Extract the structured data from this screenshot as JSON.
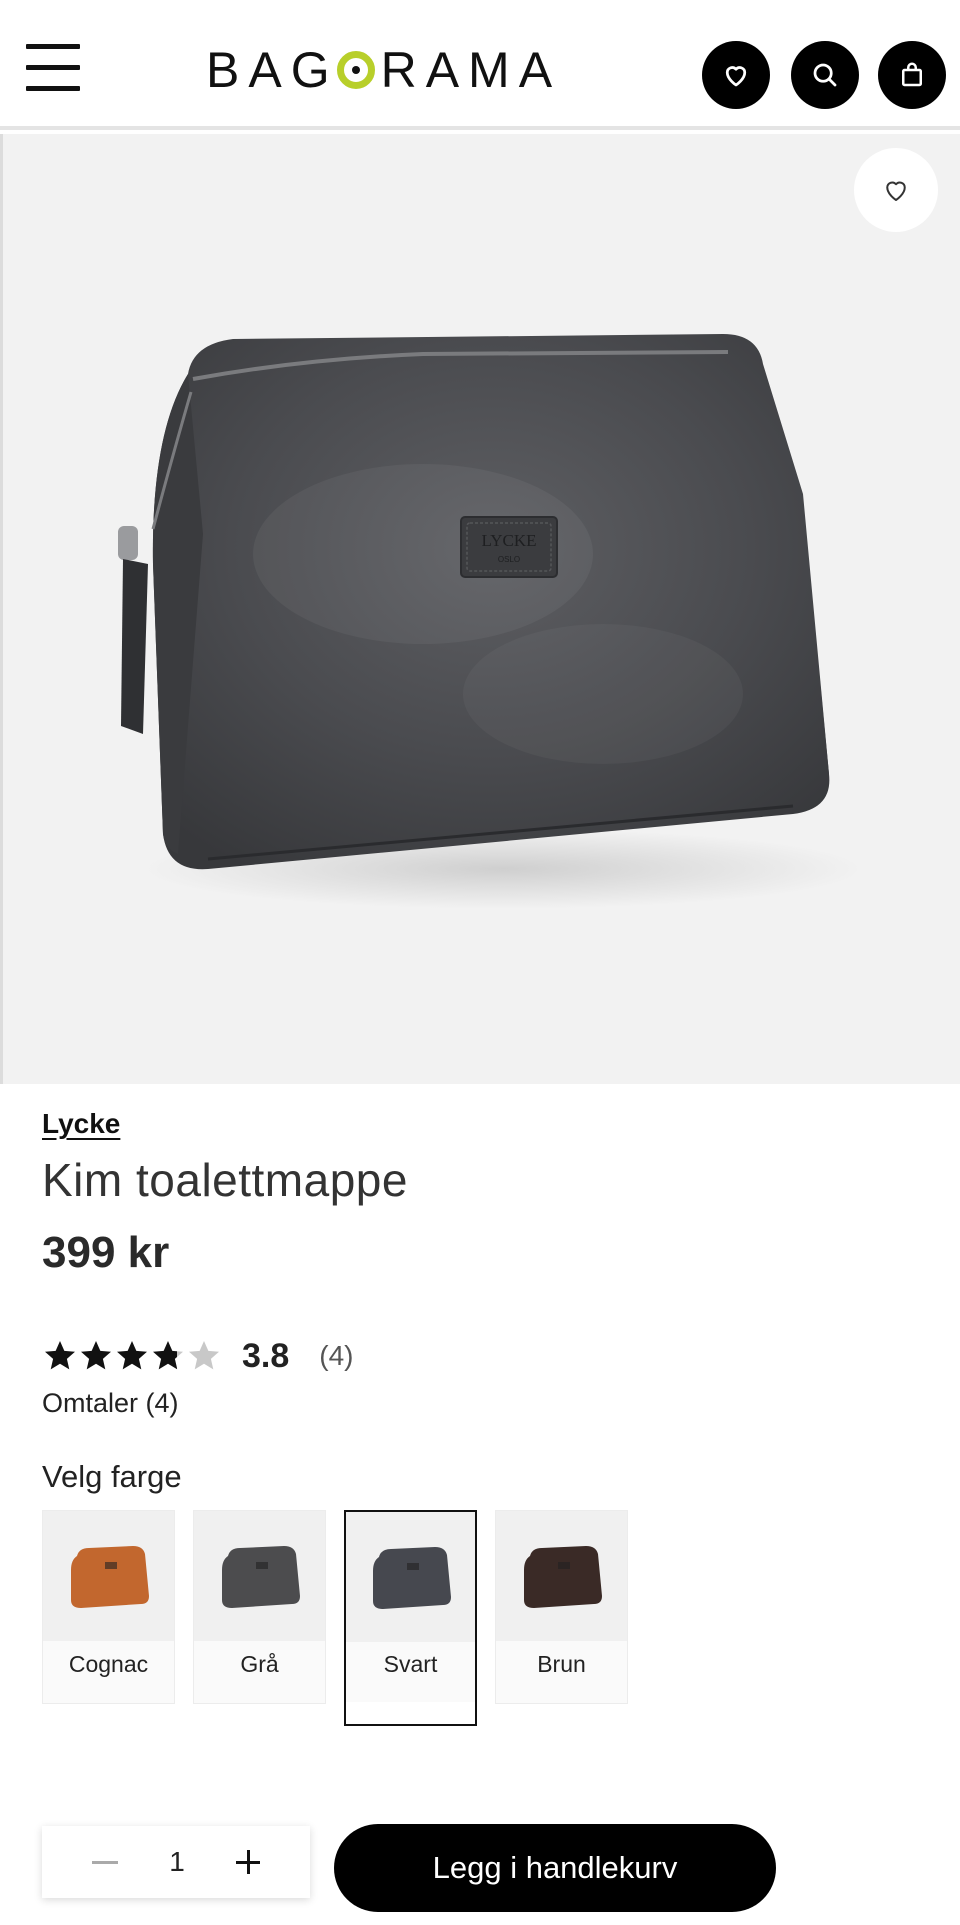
{
  "header": {
    "logo_text": "BAGORAMA",
    "icons": [
      "menu-icon",
      "heart-icon",
      "search-icon",
      "bag-icon"
    ],
    "accent_color": "#b8cf2a"
  },
  "product": {
    "brand": "Lycke",
    "title": "Kim toalettmappe",
    "price": "399 kr",
    "rating": {
      "value": "3.8",
      "count": "(4)",
      "stars_fraction": 0.76
    },
    "reviews_link": "Omtaler (4)",
    "image_label_line1": "LYCKE",
    "image_label_line2": "OSLO"
  },
  "colors": {
    "label": "Velg farge",
    "options": [
      {
        "name": "Cognac",
        "hex": "#c2672e",
        "selected": false
      },
      {
        "name": "Grå",
        "hex": "#4c4c4e",
        "selected": false
      },
      {
        "name": "Svart",
        "hex": "#46484f",
        "selected": true
      },
      {
        "name": "Brun",
        "hex": "#3a2a26",
        "selected": false
      }
    ]
  },
  "cart": {
    "quantity": "1",
    "add_button": "Legg i handlekurv"
  }
}
